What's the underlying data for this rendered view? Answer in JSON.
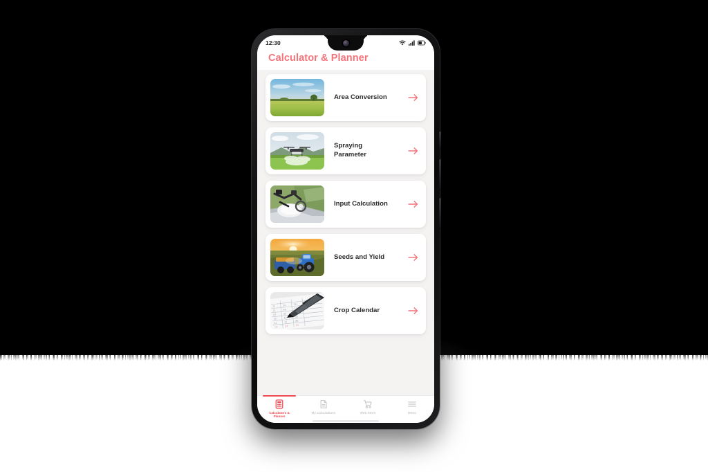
{
  "backdrop": {
    "top_color": "#000000",
    "bottom_color": "#ffffff"
  },
  "device": {
    "frame_color": "#121214",
    "screen_background": "#f4f3f2"
  },
  "status_bar": {
    "time": "12:30",
    "icons": [
      "wifi-icon",
      "cellular-signal-icon",
      "battery-icon"
    ]
  },
  "header": {
    "title": "Calculator & Planner",
    "title_color": "#f4737b"
  },
  "theme": {
    "accent": "#ef4a53",
    "arrow_color": "#f4737b",
    "card_background": "#ffffff",
    "text_color": "#2b2b2e"
  },
  "main": {
    "cards": [
      {
        "label": "Area Conversion",
        "thumb": "field-sunset-thumb",
        "arrow": "arrow-right-icon"
      },
      {
        "label": "Spraying\nParameter",
        "thumb": "spraying-drone-thumb",
        "arrow": "arrow-right-icon"
      },
      {
        "label": "Input Calculation",
        "thumb": "sprayer-equipment-thumb",
        "arrow": "arrow-right-icon"
      },
      {
        "label": "Seeds and Yield",
        "thumb": "tractor-harvest-thumb",
        "arrow": "arrow-right-icon"
      },
      {
        "label": "Crop Calendar",
        "thumb": "pen-calendar-thumb",
        "arrow": "arrow-right-icon"
      }
    ]
  },
  "bottom_nav": {
    "items": [
      {
        "label": "Calculators &\nPlanner",
        "icon": "calculator-icon",
        "active": true
      },
      {
        "label": "My Calculations",
        "icon": "document-icon",
        "active": false
      },
      {
        "label": "Web Store",
        "icon": "shopping-cart-icon",
        "active": false
      },
      {
        "label": "Menu",
        "icon": "hamburger-menu-icon",
        "active": false
      }
    ]
  }
}
